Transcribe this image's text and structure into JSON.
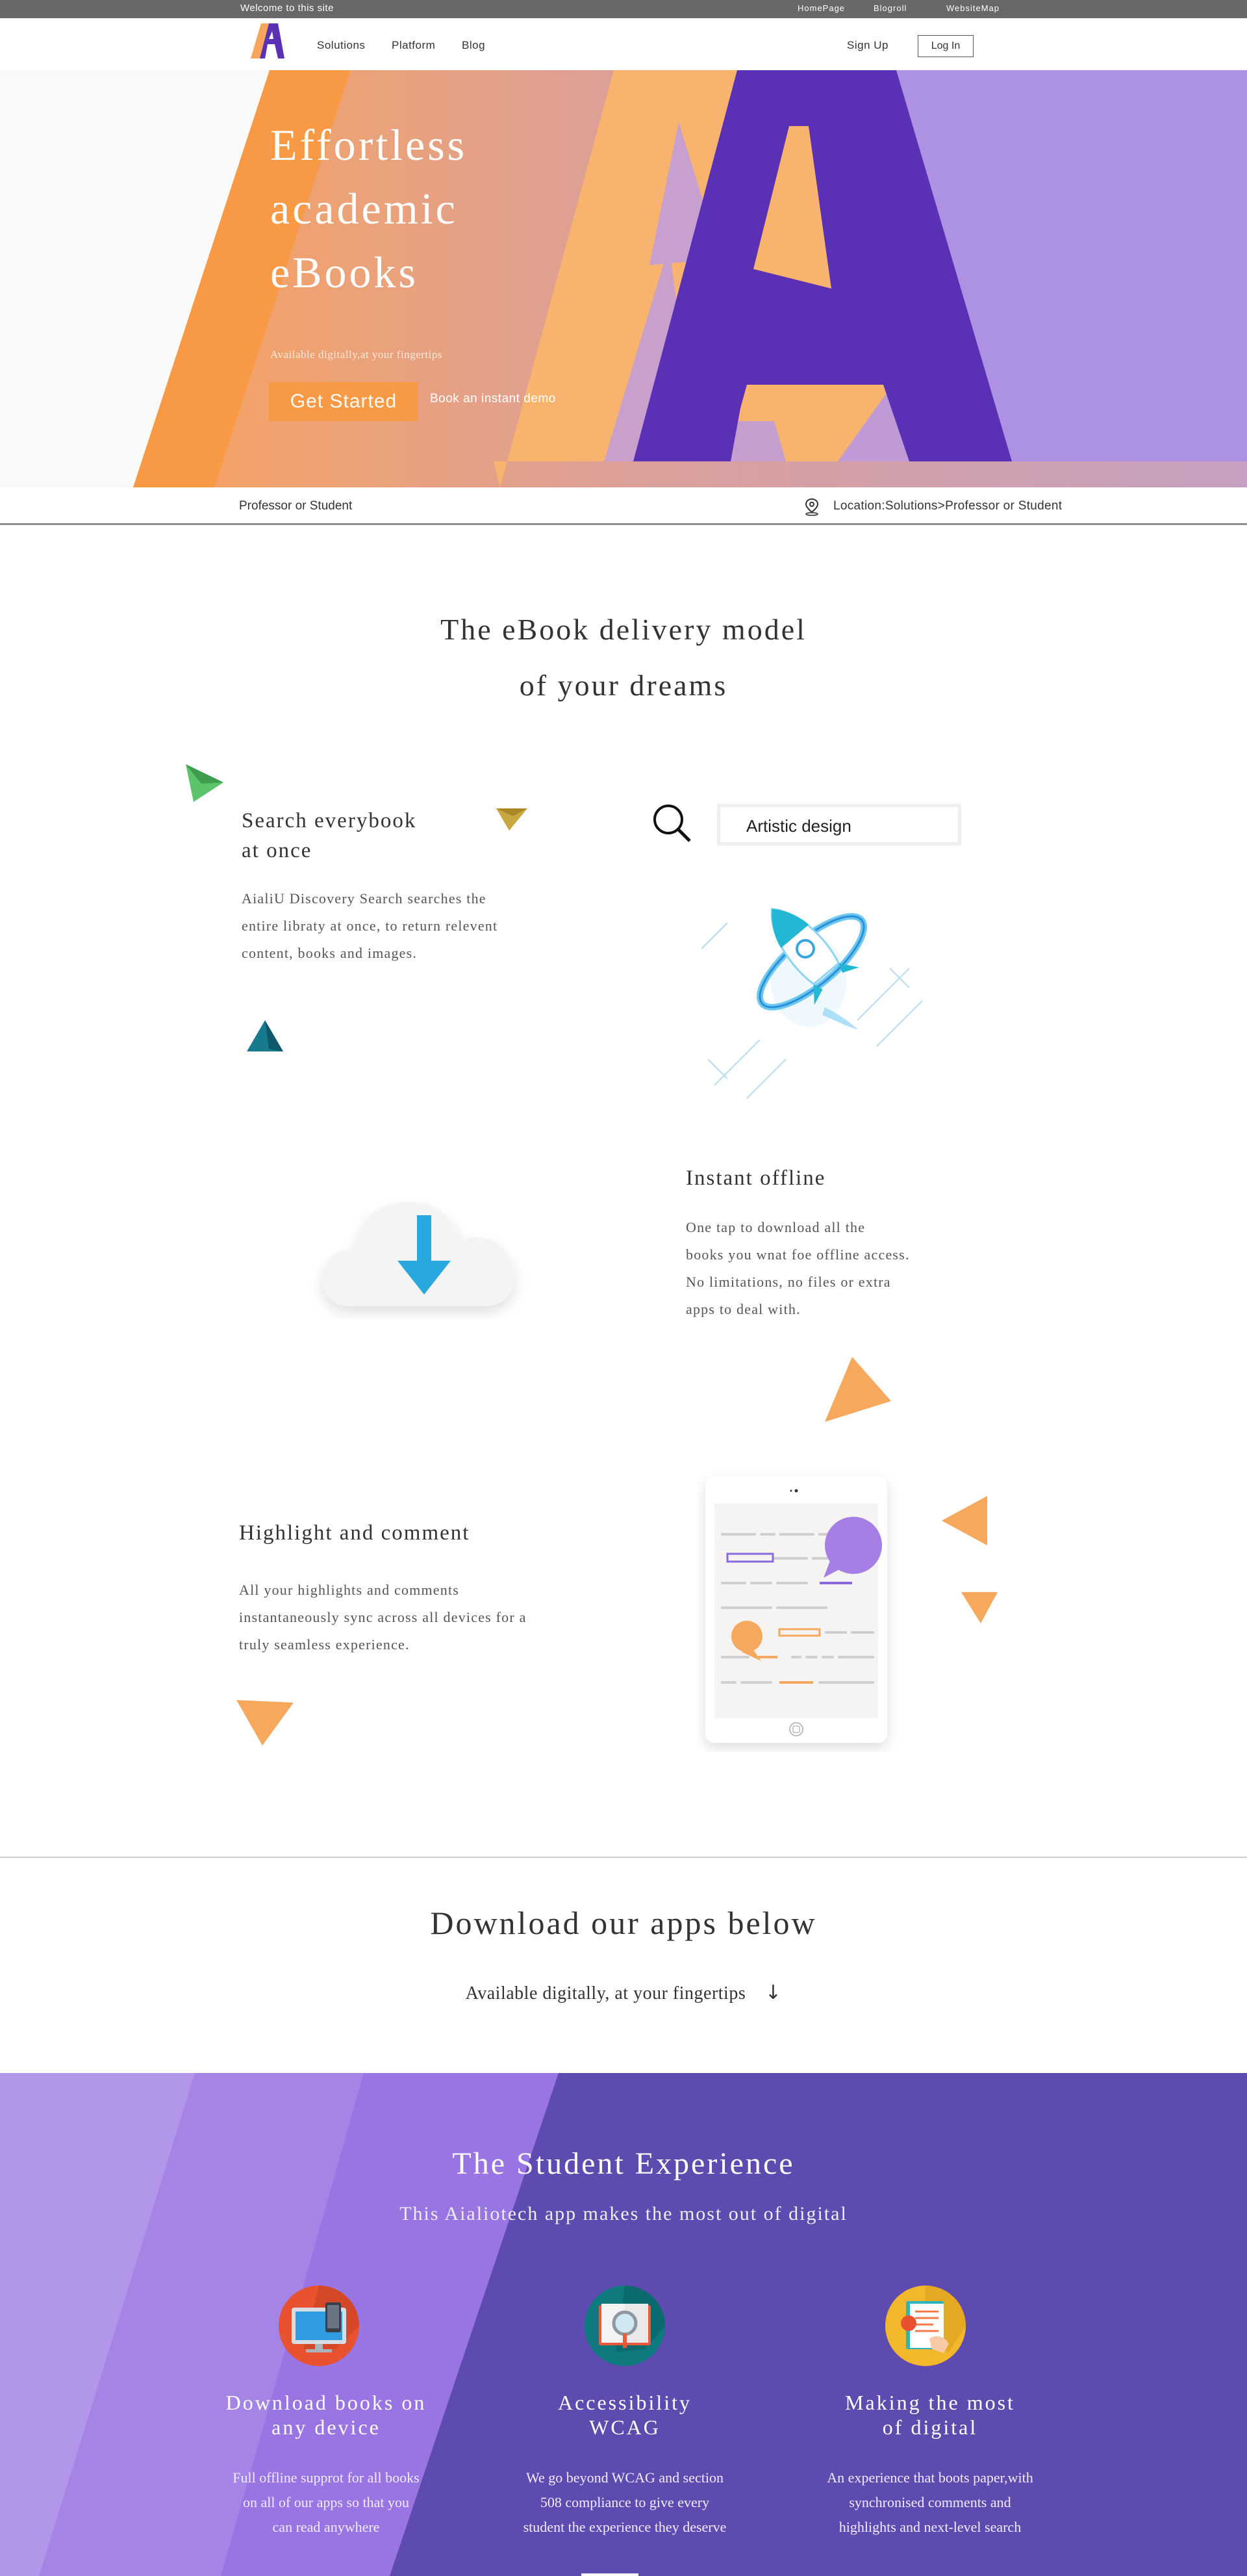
{
  "topbar": {
    "welcome": "Welcome to this site",
    "links": [
      "HomePage",
      "Blogroll",
      "WebsiteMap"
    ]
  },
  "nav": {
    "logo_icon": "letter-a-logo-icon",
    "items": [
      "Solutions",
      "Platform",
      "Blog"
    ],
    "signup": "Sign Up",
    "login": "Log In"
  },
  "hero": {
    "title_lines": [
      "Effortless",
      "academic",
      "eBooks"
    ],
    "subtitle": "Available digitally,at your fingertips",
    "primary_button": "Get Started",
    "secondary_link": "Book an instant demo",
    "colors": {
      "orange": "#f89a45",
      "purple": "#5a30b5",
      "lilac": "#ad92e4"
    }
  },
  "breadcrumb": {
    "left": "Professor or Student",
    "location": "Location:Solutions>Professor or Student",
    "icon": "map-pin-icon"
  },
  "features": {
    "section_title_lines": [
      "The eBook delivery model",
      "of your dreams"
    ],
    "items": [
      {
        "heading_lines": [
          "Search everybook",
          "at once"
        ],
        "body_lines": [
          "AialiU Discovery Search searches the",
          "entire libraty at once, to return relevent",
          "content, books and images."
        ],
        "icon": "rocket-illustration"
      },
      {
        "heading_lines": [
          "Instant offline"
        ],
        "body_lines": [
          "One tap to download all the",
          "books you wnat foe offline access.",
          "No limitations, no files or extra",
          "apps to deal with."
        ],
        "icon": "cloud-download-icon"
      },
      {
        "heading_lines": [
          "Highlight and comment"
        ],
        "body_lines": [
          "All your highlights and comments",
          "instantaneously sync across all devices for a",
          "truly seamless experience."
        ],
        "icon": "tablet-comment-illustration"
      }
    ],
    "search_value": "Artistic design"
  },
  "download": {
    "title": "Download our apps below",
    "subtitle": "Available digitally, at your fingertips",
    "arrow": "↓"
  },
  "student": {
    "title": "The Student Experience",
    "subtitle": "This Aialiotech app makes the most out of digital",
    "columns": [
      {
        "heading_lines": [
          "Download books on",
          "any device"
        ],
        "body_lines": [
          "Full offline supprot for all books",
          "on all of our apps so that you",
          "can read anywhere"
        ],
        "icon": "monitor-icon",
        "icon_color": "#e8522e"
      },
      {
        "heading_lines": [
          "Accessibility",
          "WCAG"
        ],
        "body_lines": [
          "We go beyond WCAG and section",
          "508 compliance to give every",
          "student the experience they deserve"
        ],
        "icon": "book-magnifier-icon",
        "icon_color": "#0e7a7e"
      },
      {
        "heading_lines": [
          "Making the most",
          "of digital"
        ],
        "body_lines": [
          "An experience that boots paper,with",
          "synchronised comments and",
          "highlights and next-level search"
        ],
        "icon": "document-hand-icon",
        "icon_color": "#f3b72c"
      }
    ]
  }
}
